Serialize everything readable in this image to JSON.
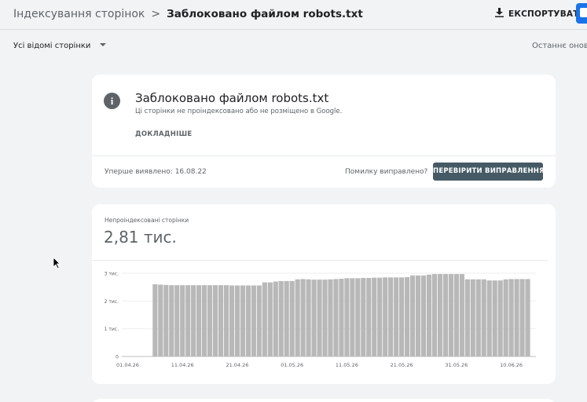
{
  "header": {
    "breadcrumb_parent": "Індексування сторінок",
    "breadcrumb_sep": ">",
    "breadcrumb_current": "Заблоковано файлом robots.txt",
    "export_label": "ЕКСПОРТУВАТИ",
    "export_icon": "download-icon",
    "share_icon": "share-icon",
    "accent": "#1a73e8"
  },
  "filter": {
    "selected": "Усі відомі сторінки",
    "caret_icon": "chevron-down-icon"
  },
  "updated_text": "Останнє оновл",
  "issue": {
    "icon": "info-icon",
    "info_glyph": "i",
    "title": "Заблоковано файлом robots.txt",
    "subtitle": "Ці сторінки не проіндексовано або не розміщено в Google.",
    "more_label": "ДОКЛАДНІШЕ",
    "first_detected": "Уперше виявлено: 16.08.22",
    "fixed_question": "Помилку виправлено?",
    "validate_label": "ПЕРЕВІРИТИ ВИПРАВЛЕННЯ",
    "validate_color": "#455a64"
  },
  "stats": {
    "label": "Непроіндексовані сторінки",
    "value": "2,81 тис."
  },
  "chart_data": {
    "type": "bar",
    "color": "#b8b8b8",
    "y_ticks": [
      {
        "value": 0,
        "label": "0"
      },
      {
        "value": 1000,
        "label": "1 тис."
      },
      {
        "value": 2000,
        "label": "2 тис."
      },
      {
        "value": 3000,
        "label": "3 тис."
      }
    ],
    "ylim": [
      0,
      3000
    ],
    "x_tick_labels": [
      "01.04.26",
      "11.04.26",
      "21.04.26",
      "01.05.26",
      "11.05.26",
      "21.05.26",
      "31.05.26",
      "10.06.26"
    ],
    "categories": [
      "01.04.26",
      "02.04.26",
      "03.04.26",
      "04.04.26",
      "05.04.26",
      "06.04.26",
      "07.04.26",
      "08.04.26",
      "09.04.26",
      "10.04.26",
      "11.04.26",
      "12.04.26",
      "13.04.26",
      "14.04.26",
      "15.04.26",
      "16.04.26",
      "17.04.26",
      "18.04.26",
      "19.04.26",
      "20.04.26",
      "21.04.26",
      "22.04.26",
      "23.04.26",
      "24.04.26",
      "25.04.26",
      "26.04.26",
      "27.04.26",
      "28.04.26",
      "29.04.26",
      "30.04.26",
      "01.05.26",
      "02.05.26",
      "03.05.26",
      "04.05.26",
      "05.05.26",
      "06.05.26",
      "07.05.26",
      "08.05.26",
      "09.05.26",
      "10.05.26",
      "11.05.26",
      "12.05.26",
      "13.05.26",
      "14.05.26",
      "15.05.26",
      "16.05.26",
      "17.05.26",
      "18.05.26",
      "19.05.26",
      "20.05.26",
      "21.05.26",
      "22.05.26",
      "23.05.26",
      "24.05.26",
      "25.05.26",
      "26.05.26",
      "27.05.26",
      "28.05.26",
      "29.05.26",
      "30.05.26",
      "31.05.26",
      "01.06.26",
      "02.06.26",
      "03.06.26",
      "04.06.26",
      "05.06.26",
      "06.06.26",
      "07.06.26",
      "08.06.26",
      "09.06.26",
      "10.06.26",
      "11.06.26",
      "12.06.26",
      "13.06.26"
    ],
    "values": [
      0,
      0,
      0,
      0,
      0,
      2600,
      2590,
      2580,
      2570,
      2570,
      2570,
      2570,
      2570,
      2570,
      2570,
      2570,
      2570,
      2570,
      2570,
      2560,
      2560,
      2560,
      2560,
      2560,
      2560,
      2670,
      2670,
      2700,
      2720,
      2720,
      2720,
      2780,
      2790,
      2780,
      2770,
      2770,
      2770,
      2780,
      2790,
      2800,
      2820,
      2820,
      2820,
      2830,
      2830,
      2840,
      2840,
      2850,
      2850,
      2850,
      2850,
      2860,
      2920,
      2920,
      2920,
      2950,
      2970,
      2970,
      2970,
      2970,
      2970,
      2970,
      2780,
      2780,
      2780,
      2780,
      2740,
      2740,
      2740,
      2780,
      2790,
      2790,
      2790,
      2790
    ]
  }
}
